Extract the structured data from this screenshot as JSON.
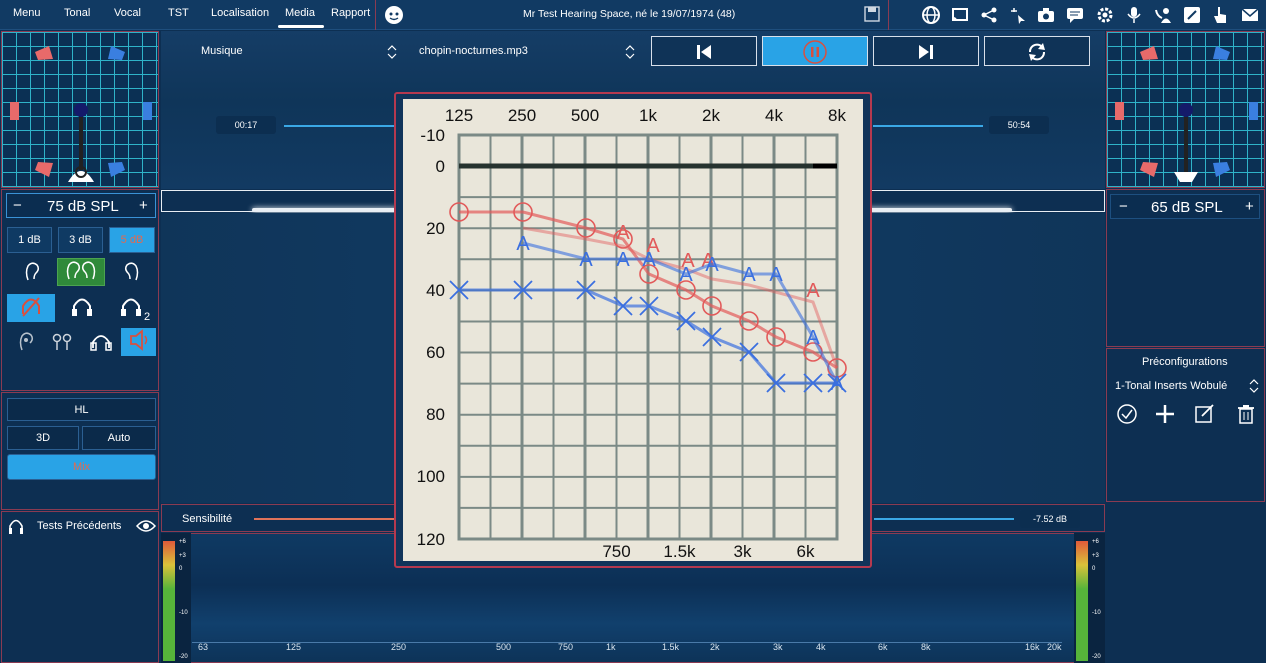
{
  "menu": {
    "items": [
      "Menu",
      "Tonal",
      "Vocal",
      "TST",
      "Localisation",
      "Media",
      "Rapport"
    ],
    "active": "Media"
  },
  "header": {
    "title": "Mr Test Hearing Space, né le 19/07/1974 (48)"
  },
  "left": {
    "spl": {
      "minus": "−",
      "value": "75 dB SPL",
      "plus": "+"
    },
    "steps": [
      "1 dB",
      "3 dB",
      "5 dB"
    ],
    "active_step": "5 dB",
    "hl_label": "HL",
    "mode_3d": "3D",
    "mode_auto": "Auto",
    "mix_label": "Mix",
    "prev_tests": "Tests Précédents"
  },
  "right": {
    "spl": {
      "minus": "−",
      "value": "65 dB SPL",
      "plus": "+"
    },
    "presets_title": "Préconfigurations",
    "preset_selected": "1-Tonal Inserts Wobulé"
  },
  "media": {
    "category": "Musique",
    "file": "chopin-nocturnes.mp3",
    "time_elapsed": "00:17",
    "time_total": "50:54",
    "sensitivity_label": "Sensibilité",
    "sensitivity_value": "-7.52 dB"
  },
  "meters": {
    "labels": [
      "+6",
      "+3",
      "0",
      "-10",
      "-20"
    ]
  },
  "spectrum_axis": {
    "ticks": [
      "63",
      "125",
      "250",
      "500",
      "750",
      "1k",
      "1.5k",
      "2k",
      "3k",
      "4k",
      "6k",
      "8k",
      "16k",
      "20k"
    ]
  },
  "audiogram": {
    "top_freqs": [
      "125",
      "250",
      "500",
      "1k",
      "2k",
      "4k",
      "8k"
    ],
    "bottom_freqs": [
      "750",
      "1.5k",
      "3k",
      "6k"
    ],
    "db_labels": [
      "-10",
      "0",
      "20",
      "40",
      "60",
      "80",
      "100",
      "120"
    ],
    "colors": {
      "right": "#e25a5a",
      "left": "#3a6fe0",
      "bg": "#eae6da",
      "grid": "#7b8a86"
    }
  }
}
